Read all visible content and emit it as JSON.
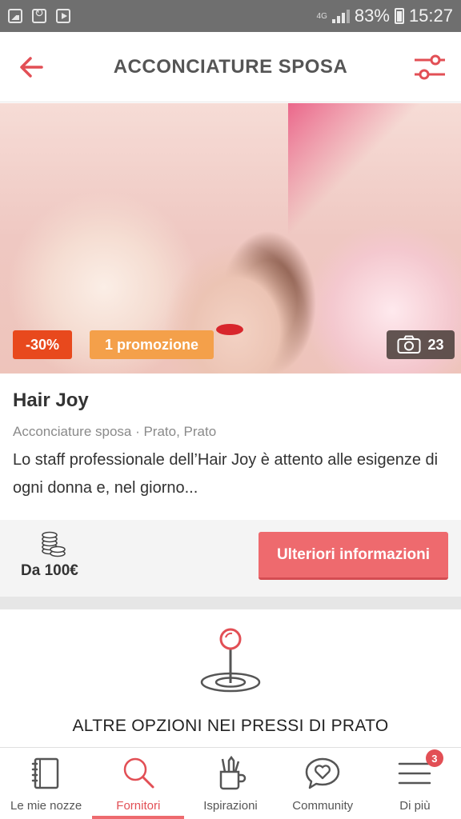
{
  "status_bar": {
    "network": "4G",
    "battery": "83%",
    "time": "15:27"
  },
  "header": {
    "title": "ACCONCIATURE SPOSA",
    "back_icon": "arrow-left-icon",
    "filter_icon": "sliders-icon"
  },
  "listing": {
    "discount_badge": "-30%",
    "promo_badge": "1 promozione",
    "photo_count": "23",
    "name": "Hair Joy",
    "meta": "Acconciature sposa · Prato, Prato",
    "description": "Lo staff professionale dell’Hair Joy è attento alle esigenze di ogni donna e, nel giorno...",
    "price": "Da 100€",
    "cta_label": "Ulteriori informazioni"
  },
  "nearby": {
    "title": "ALTRE OPZIONI NEI PRESSI DI PRATO"
  },
  "bottom_nav": {
    "items": [
      {
        "label": "Le mie nozze",
        "icon": "notebook-icon"
      },
      {
        "label": "Fornitori",
        "icon": "search-icon"
      },
      {
        "label": "Ispirazioni",
        "icon": "tools-cup-icon"
      },
      {
        "label": "Community",
        "icon": "chat-heart-icon"
      },
      {
        "label": "Di più",
        "icon": "menu-icon"
      }
    ],
    "active_index": 1,
    "notification_count": "3"
  },
  "colors": {
    "accent": "#ee6a6e",
    "discount": "#e8491d",
    "promo": "#f4a04a",
    "status_bar": "#6f6f6f"
  }
}
